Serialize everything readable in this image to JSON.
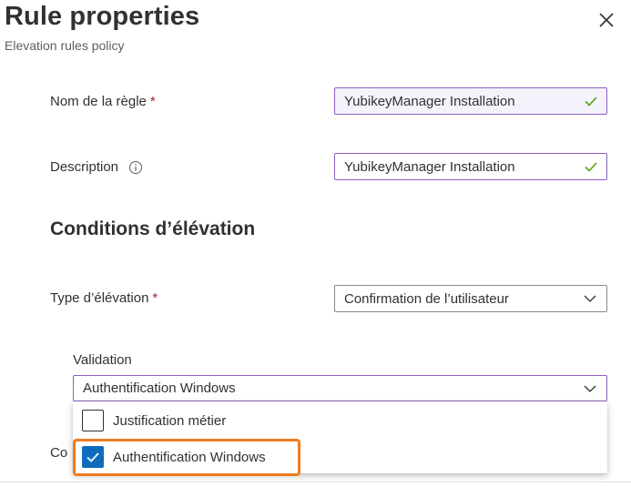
{
  "header": {
    "title": "Rule properties",
    "subtitle": "Elevation rules policy",
    "close_icon": "close-icon"
  },
  "form": {
    "rule_name": {
      "label": "Nom de la règle",
      "required": "*",
      "value": "YubikeyManager Installation"
    },
    "description": {
      "label": "Description",
      "value": "YubikeyManager Installation",
      "info_icon": "info-icon"
    },
    "section_title": "Conditions d’élévation",
    "elevation_type": {
      "label": "Type d’élévation",
      "required": "*",
      "value": "Confirmation de l’utilisateur"
    },
    "validation": {
      "label": "Validation",
      "value": "Authentification Windows",
      "options": [
        {
          "label": "Justification métier",
          "checked": false
        },
        {
          "label": "Authentification Windows",
          "checked": true
        }
      ]
    },
    "partial_label": "Co"
  },
  "colors": {
    "accent": "#0f6cbd",
    "focus_border": "#8a5fbf",
    "valid_check": "#57a300",
    "required": "#a4262c",
    "highlight": "#ef7d22"
  }
}
